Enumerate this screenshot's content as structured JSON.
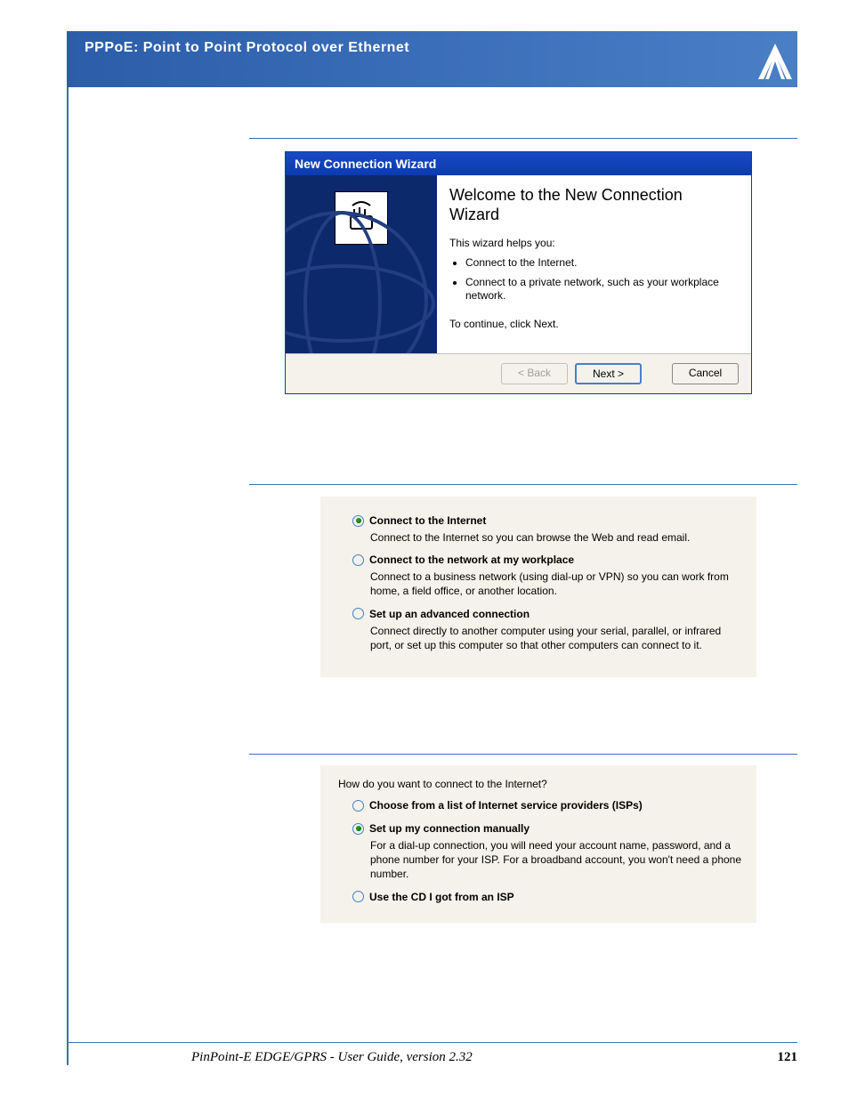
{
  "header": {
    "title": "PPPoE: Point to Point Protocol over Ethernet"
  },
  "wizard": {
    "titlebar": "New Connection Wizard",
    "heading": "Welcome to the New Connection Wizard",
    "intro": "This wizard helps you:",
    "bullets": [
      "Connect to the Internet.",
      "Connect to a private network, such as your workplace network."
    ],
    "continue_text": "To continue, click Next.",
    "buttons": {
      "back": "< Back",
      "next": "Next >",
      "cancel": "Cancel"
    }
  },
  "panel1": {
    "options": [
      {
        "label": "Connect to the Internet",
        "desc": "Connect to the Internet so you can browse the Web and read email.",
        "selected": true
      },
      {
        "label": "Connect to the network at my workplace",
        "desc": "Connect to a business network (using dial-up or VPN) so you can work from home, a field office, or another location.",
        "selected": false
      },
      {
        "label": "Set up an advanced connection",
        "desc": "Connect directly to another computer using your serial, parallel, or infrared port, or set up this computer so that other computers can connect to it.",
        "selected": false
      }
    ]
  },
  "panel2": {
    "prompt": "How do you want to connect to the Internet?",
    "options": [
      {
        "label": "Choose from a list of Internet service providers (ISPs)",
        "desc": "",
        "selected": false
      },
      {
        "label": "Set up my connection manually",
        "desc": "For a dial-up connection, you will need your account name, password, and a phone number for your ISP. For a broadband account, you won't need a phone number.",
        "selected": true
      },
      {
        "label": "Use the CD I got from an ISP",
        "desc": "",
        "selected": false
      }
    ]
  },
  "footer": {
    "doc_title": "PinPoint-E EDGE/GPRS - User Guide, version 2.32",
    "page_number": "121"
  }
}
